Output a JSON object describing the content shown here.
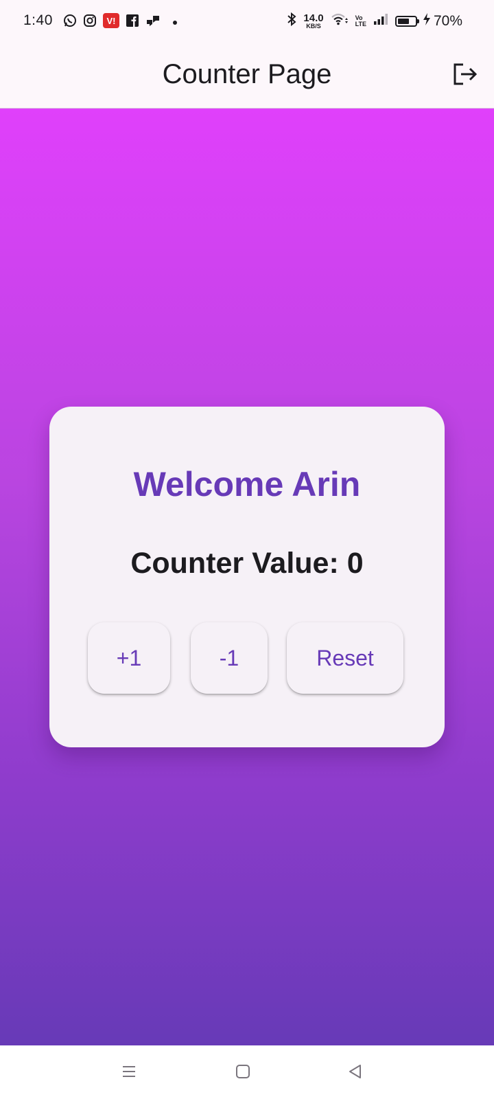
{
  "status_bar": {
    "time": "1:40",
    "net_speed_value": "14.0",
    "net_speed_unit": "KB/S",
    "volte_top": "Vo",
    "volte_bottom": "LTE",
    "battery_percent": "70%",
    "battery_level": 0.7,
    "notification_icons": [
      "whatsapp-icon",
      "instagram-icon",
      "vi-app-icon",
      "facebook-icon",
      "messaging-icon",
      "dot-icon"
    ]
  },
  "app_bar": {
    "title": "Counter Page",
    "action_icon": "logout-icon"
  },
  "card": {
    "welcome_text": "Welcome Arin",
    "counter_text": "Counter Value: 0",
    "buttons": {
      "increment": "+1",
      "decrement": "-1",
      "reset": "Reset"
    }
  },
  "nav_bar": {
    "icons": [
      "menu-icon",
      "home-icon",
      "back-icon"
    ]
  },
  "colors": {
    "accent": "#673ab7",
    "gradient_top": "#e040fb",
    "gradient_bottom": "#673ab7",
    "card_bg": "#f6f1f7"
  }
}
